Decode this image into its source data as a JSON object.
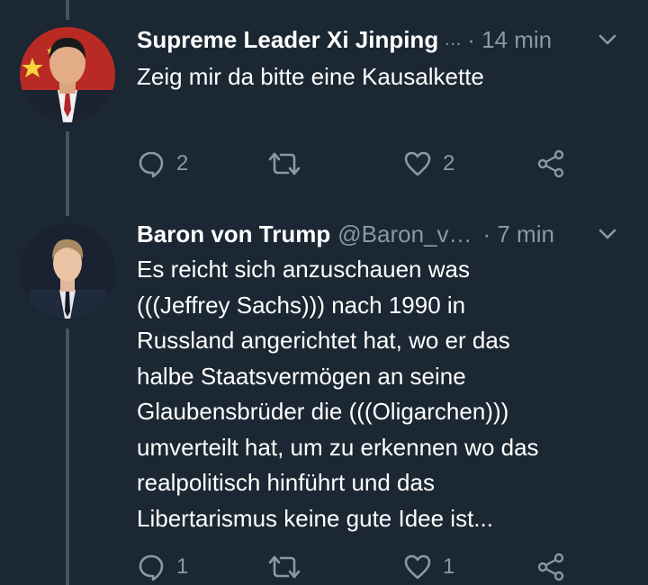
{
  "tweets": [
    {
      "display_name": "Supreme Leader Xi Jinping",
      "handle": "",
      "ellipsis": "…",
      "time": "· 14 min",
      "text": "Zeig mir da bitte eine Kausalkette",
      "reply_count": "2",
      "retweet_count": "",
      "like_count": "2",
      "avatar_icon": "portrait-with-flag-icon"
    },
    {
      "display_name": "Baron von Trump",
      "handle": "@Baron_v…",
      "ellipsis": "",
      "time": "· 7 min",
      "text_lines": [
        "Es reicht sich anzuschauen was",
        "(((Jeffrey Sachs))) nach 1990 in",
        "Russland angerichtet hat, wo er das",
        "halbe Staatsvermögen an seine",
        "Glaubensbrüder die (((Oligarchen)))",
        "umverteilt hat, um zu erkennen wo das",
        "realpolitisch hinführt und das",
        "Libertarismus keine gute Idee ist..."
      ],
      "reply_count": "1",
      "retweet_count": "",
      "like_count": "1",
      "avatar_icon": "portrait-icon"
    }
  ],
  "colors": {
    "background": "#1b2733",
    "text_primary": "#ffffff",
    "text_secondary": "#8899a6",
    "thread_line": "#425364"
  }
}
